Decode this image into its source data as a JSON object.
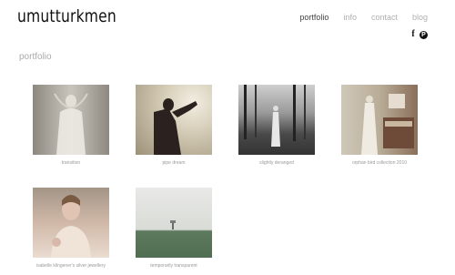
{
  "site": {
    "logo": "umutturkmen"
  },
  "nav": [
    {
      "label": "portfolio",
      "active": true
    },
    {
      "label": "info",
      "active": false
    },
    {
      "label": "contact",
      "active": false
    },
    {
      "label": "blog",
      "active": false
    }
  ],
  "social": {
    "facebook": "f",
    "pinterest": "P"
  },
  "section": {
    "title": "portfolio"
  },
  "items": [
    {
      "caption": "transition"
    },
    {
      "caption": "pipe dream"
    },
    {
      "caption": "slightly deranged"
    },
    {
      "caption": "orphan bird collection 2010"
    },
    {
      "caption": "isabelle klingener's silver jewellery"
    },
    {
      "caption": "temporarily transparent"
    }
  ]
}
